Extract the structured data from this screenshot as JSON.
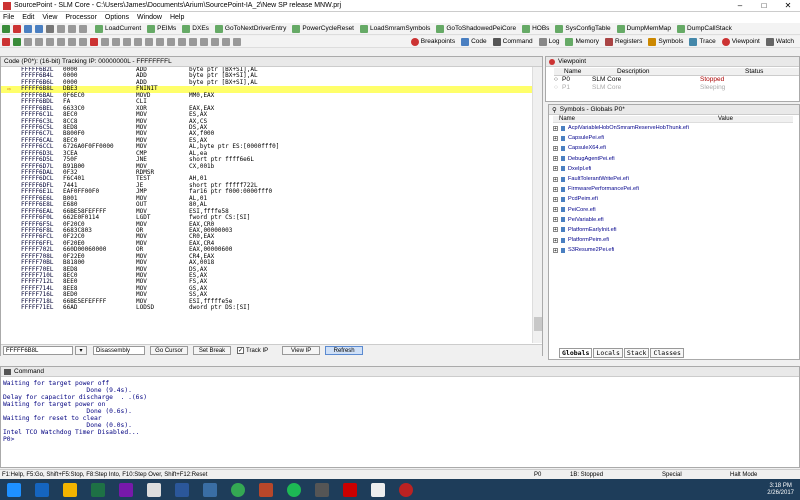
{
  "window": {
    "title": "SourcePoint - SLM Core - C:\\Users\\James\\Documents\\Arium\\SourcePoint-IA_2\\New SP release MNW.prj"
  },
  "menu": [
    "File",
    "Edit",
    "View",
    "Processor",
    "Options",
    "Window",
    "Help"
  ],
  "toolbar1": [
    "LoadCurrent",
    "PEIMs",
    "DXEs",
    "GoToNextDriverEntry",
    "PowerCycleReset",
    "LoadSmramSymbols",
    "GoToShadowedPeiCore",
    "HOBs",
    "SysConfigTable",
    "DumpMemMap",
    "DumpCallStack"
  ],
  "toolbar2": [
    "Breakpoints",
    "Code",
    "Command",
    "Log",
    "Memory",
    "Registers",
    "Symbols",
    "Trace",
    "Viewpoint",
    "Watch"
  ],
  "code": {
    "title": "Code (P0*): (16-bit) Tracking IP: 00000000L - FFFFFFFFL",
    "rows": [
      [
        "FFFFF6B2L",
        "0000",
        "ADD",
        "byte ptr [BX+SI],AL"
      ],
      [
        "FFFFF6B4L",
        "0000",
        "ADD",
        "byte ptr [BX+SI],AL"
      ],
      [
        "FFFFF6B6L",
        "0000",
        "ADD",
        "byte ptr [BX+SI],AL"
      ],
      [
        "FFFFF6B8L",
        "DBE3",
        "FNINIT",
        ""
      ],
      [
        "FFFFF6BAL",
        "0F6EC0",
        "MOVD",
        "MM0,EAX"
      ],
      [
        "FFFFF6BDL",
        "FA",
        "CLI",
        ""
      ],
      [
        "FFFFF6BEL",
        "6633C0",
        "XOR",
        "EAX,EAX"
      ],
      [
        "FFFFF6C1L",
        "8EC0",
        "MOV",
        "ES,AX"
      ],
      [
        "FFFFF6C3L",
        "8CC8",
        "MOV",
        "AX,CS"
      ],
      [
        "FFFFF6C5L",
        "8ED8",
        "MOV",
        "DS,AX"
      ],
      [
        "FFFFF6C7L",
        "B800F0",
        "MOV",
        "AX,f000"
      ],
      [
        "FFFFF6CAL",
        "8EC0",
        "MOV",
        "ES,AX"
      ],
      [
        "FFFFF6CCL",
        "6726A0F0FF0000",
        "MOV",
        "AL,byte ptr ES:[0000fff0]"
      ],
      [
        "FFFFF6D3L",
        "3CEA",
        "CMP",
        "AL,ea"
      ],
      [
        "FFFFF6D5L",
        "750F",
        "JNE",
        "short ptr ffff6e6L"
      ],
      [
        "FFFFF6D7L",
        "B91B00",
        "MOV",
        "CX,001b"
      ],
      [
        "FFFFF6DAL",
        "0F32",
        "RDMSR",
        ""
      ],
      [
        "FFFFF6DCL",
        "F6C401",
        "TEST",
        "AH,01"
      ],
      [
        "FFFFF6DFL",
        "7441",
        "JE",
        "short ptr fffff722L"
      ],
      [
        "FFFFF6E1L",
        "EAF0FF00F0",
        "JMP",
        "far16 ptr f000:0000fff0"
      ],
      [
        "FFFFF6E6L",
        "B001",
        "MOV",
        "AL,01"
      ],
      [
        "FFFFF6E8L",
        "E680",
        "OUT",
        "80,AL"
      ],
      [
        "FFFFF6EAL",
        "66BE58FEFFFF",
        "MOV",
        "ESI,ffffe58"
      ],
      [
        "FFFFF6F0L",
        "662E0F0114",
        "LGDT",
        "fword ptr CS:[SI]"
      ],
      [
        "FFFFF6F5L",
        "0F20C0",
        "MOV",
        "EAX,CR0"
      ],
      [
        "FFFFF6F8L",
        "6683C803",
        "OR",
        "EAX,00000003"
      ],
      [
        "FFFFF6FCL",
        "0F22C0",
        "MOV",
        "CR0,EAX"
      ],
      [
        "FFFFF6FFL",
        "0F20E0",
        "MOV",
        "EAX,CR4"
      ],
      [
        "FFFFF702L",
        "660D00060000",
        "OR",
        "EAX,00000600"
      ],
      [
        "FFFFF708L",
        "0F22E0",
        "MOV",
        "CR4,EAX"
      ],
      [
        "FFFFF70BL",
        "B81800",
        "MOV",
        "AX,0018"
      ],
      [
        "FFFFF70EL",
        "8ED8",
        "MOV",
        "DS,AX"
      ],
      [
        "FFFFF710L",
        "8EC0",
        "MOV",
        "ES,AX"
      ],
      [
        "FFFFF712L",
        "8EE0",
        "MOV",
        "FS,AX"
      ],
      [
        "FFFFF714L",
        "8EE8",
        "MOV",
        "GS,AX"
      ],
      [
        "FFFFF716L",
        "8ED0",
        "MOV",
        "SS,AX"
      ],
      [
        "FFFFF718L",
        "66BE5EFEFFFF",
        "MOV",
        "ESI,fffffe5e"
      ],
      [
        "FFFFF71EL",
        "66AD",
        "LODSD",
        "dword ptr DS:[SI]"
      ]
    ],
    "address_input": "FFFFF6B8L",
    "mode": "Disassembly",
    "buttons": [
      "Go Cursor",
      "Set Break",
      "Track IP",
      "View IP",
      "Refresh"
    ]
  },
  "viewpoint": {
    "title": "Viewpoint",
    "headers": [
      "Name",
      "Description",
      "Status"
    ],
    "rows": [
      [
        "P0",
        "SLM Core",
        "Stopped"
      ],
      [
        "P1",
        "SLM Core",
        "Sleeping"
      ]
    ]
  },
  "symbols": {
    "title": "Symbols - Globals P0*",
    "headers": [
      "Name",
      "Value"
    ],
    "items": [
      "AcpiVariableHobOnSmramReserveHobThunk.efi",
      "CapsulePei.efi",
      "CapsuleX64.efi",
      "DebugAgentPei.efi",
      "DxeIpl.efi",
      "FaultTolerantWritePei.efi",
      "FirmwarePerformancePei.efi",
      "PcdPeim.efi",
      "PeiCore.efi",
      "PeiVariable.efi",
      "PlatformEarlyInit.efi",
      "PlatformPeim.efi",
      "S3Resume2Pei.efi"
    ],
    "tabs": [
      "Globals",
      "Locals",
      "Stack",
      "Classes"
    ]
  },
  "command": {
    "title": "Command",
    "lines": [
      "Waiting for target power off",
      "                      Done (9.4s).",
      "Delay for capacitor discharge  . .(6s)",
      "Waiting for target power on",
      "                      Done (0.6s).",
      "Waiting for reset to clear",
      "                      Done (0.0s).",
      "Intel TCO Watchdog Timer Disabled...",
      "P0>"
    ]
  },
  "status": {
    "help": "F1:Help, F5:Go, Shift+F5:Stop, F8:Step Into, F10:Step Over, Shift+F12:Reset",
    "proc": "P0",
    "state": "1B: Stopped",
    "mode": "Special",
    "halt": "Halt Mode"
  },
  "taskbar": {
    "time": "3:18 PM",
    "date": "2/26/2017"
  }
}
